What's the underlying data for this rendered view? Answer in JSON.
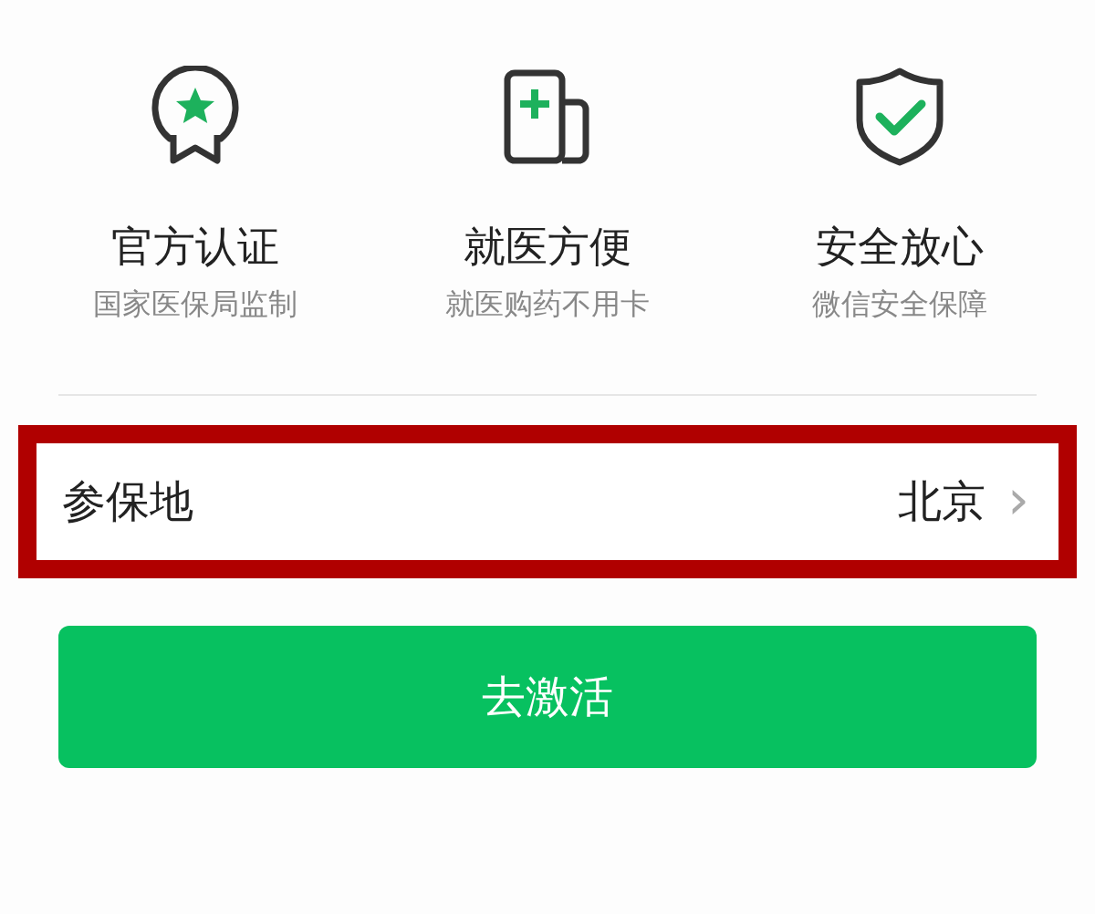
{
  "features": [
    {
      "kind": "ribbon",
      "title": "官方认证",
      "subtitle": "国家医保局监制"
    },
    {
      "kind": "card",
      "title": "就医方便",
      "subtitle": "就医购药不用卡"
    },
    {
      "kind": "shield",
      "title": "安全放心",
      "subtitle": "微信安全保障"
    }
  ],
  "location_row": {
    "label": "参保地",
    "value": "北京",
    "chevron": "›",
    "highlighted": true
  },
  "activate_button": {
    "label": "去激活"
  }
}
